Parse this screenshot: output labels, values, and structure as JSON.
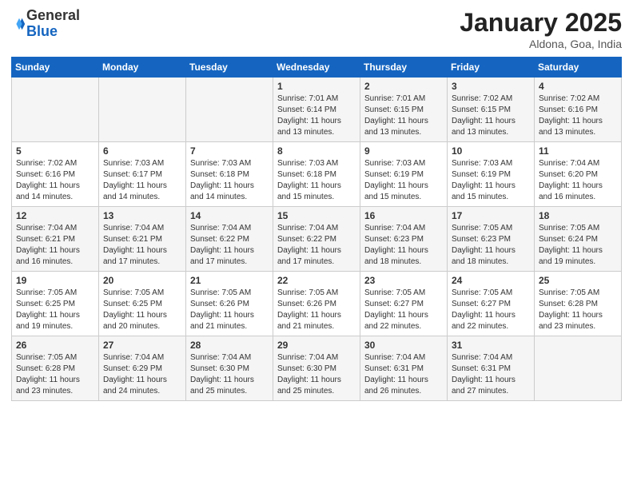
{
  "logo": {
    "general": "General",
    "blue": "Blue"
  },
  "header": {
    "title": "January 2025",
    "subtitle": "Aldona, Goa, India"
  },
  "weekdays": [
    "Sunday",
    "Monday",
    "Tuesday",
    "Wednesday",
    "Thursday",
    "Friday",
    "Saturday"
  ],
  "weeks": [
    [
      {
        "day": "",
        "info": ""
      },
      {
        "day": "",
        "info": ""
      },
      {
        "day": "",
        "info": ""
      },
      {
        "day": "1",
        "info": "Sunrise: 7:01 AM\nSunset: 6:14 PM\nDaylight: 11 hours\nand 13 minutes."
      },
      {
        "day": "2",
        "info": "Sunrise: 7:01 AM\nSunset: 6:15 PM\nDaylight: 11 hours\nand 13 minutes."
      },
      {
        "day": "3",
        "info": "Sunrise: 7:02 AM\nSunset: 6:15 PM\nDaylight: 11 hours\nand 13 minutes."
      },
      {
        "day": "4",
        "info": "Sunrise: 7:02 AM\nSunset: 6:16 PM\nDaylight: 11 hours\nand 13 minutes."
      }
    ],
    [
      {
        "day": "5",
        "info": "Sunrise: 7:02 AM\nSunset: 6:16 PM\nDaylight: 11 hours\nand 14 minutes."
      },
      {
        "day": "6",
        "info": "Sunrise: 7:03 AM\nSunset: 6:17 PM\nDaylight: 11 hours\nand 14 minutes."
      },
      {
        "day": "7",
        "info": "Sunrise: 7:03 AM\nSunset: 6:18 PM\nDaylight: 11 hours\nand 14 minutes."
      },
      {
        "day": "8",
        "info": "Sunrise: 7:03 AM\nSunset: 6:18 PM\nDaylight: 11 hours\nand 15 minutes."
      },
      {
        "day": "9",
        "info": "Sunrise: 7:03 AM\nSunset: 6:19 PM\nDaylight: 11 hours\nand 15 minutes."
      },
      {
        "day": "10",
        "info": "Sunrise: 7:03 AM\nSunset: 6:19 PM\nDaylight: 11 hours\nand 15 minutes."
      },
      {
        "day": "11",
        "info": "Sunrise: 7:04 AM\nSunset: 6:20 PM\nDaylight: 11 hours\nand 16 minutes."
      }
    ],
    [
      {
        "day": "12",
        "info": "Sunrise: 7:04 AM\nSunset: 6:21 PM\nDaylight: 11 hours\nand 16 minutes."
      },
      {
        "day": "13",
        "info": "Sunrise: 7:04 AM\nSunset: 6:21 PM\nDaylight: 11 hours\nand 17 minutes."
      },
      {
        "day": "14",
        "info": "Sunrise: 7:04 AM\nSunset: 6:22 PM\nDaylight: 11 hours\nand 17 minutes."
      },
      {
        "day": "15",
        "info": "Sunrise: 7:04 AM\nSunset: 6:22 PM\nDaylight: 11 hours\nand 17 minutes."
      },
      {
        "day": "16",
        "info": "Sunrise: 7:04 AM\nSunset: 6:23 PM\nDaylight: 11 hours\nand 18 minutes."
      },
      {
        "day": "17",
        "info": "Sunrise: 7:05 AM\nSunset: 6:23 PM\nDaylight: 11 hours\nand 18 minutes."
      },
      {
        "day": "18",
        "info": "Sunrise: 7:05 AM\nSunset: 6:24 PM\nDaylight: 11 hours\nand 19 minutes."
      }
    ],
    [
      {
        "day": "19",
        "info": "Sunrise: 7:05 AM\nSunset: 6:25 PM\nDaylight: 11 hours\nand 19 minutes."
      },
      {
        "day": "20",
        "info": "Sunrise: 7:05 AM\nSunset: 6:25 PM\nDaylight: 11 hours\nand 20 minutes."
      },
      {
        "day": "21",
        "info": "Sunrise: 7:05 AM\nSunset: 6:26 PM\nDaylight: 11 hours\nand 21 minutes."
      },
      {
        "day": "22",
        "info": "Sunrise: 7:05 AM\nSunset: 6:26 PM\nDaylight: 11 hours\nand 21 minutes."
      },
      {
        "day": "23",
        "info": "Sunrise: 7:05 AM\nSunset: 6:27 PM\nDaylight: 11 hours\nand 22 minutes."
      },
      {
        "day": "24",
        "info": "Sunrise: 7:05 AM\nSunset: 6:27 PM\nDaylight: 11 hours\nand 22 minutes."
      },
      {
        "day": "25",
        "info": "Sunrise: 7:05 AM\nSunset: 6:28 PM\nDaylight: 11 hours\nand 23 minutes."
      }
    ],
    [
      {
        "day": "26",
        "info": "Sunrise: 7:05 AM\nSunset: 6:28 PM\nDaylight: 11 hours\nand 23 minutes."
      },
      {
        "day": "27",
        "info": "Sunrise: 7:04 AM\nSunset: 6:29 PM\nDaylight: 11 hours\nand 24 minutes."
      },
      {
        "day": "28",
        "info": "Sunrise: 7:04 AM\nSunset: 6:30 PM\nDaylight: 11 hours\nand 25 minutes."
      },
      {
        "day": "29",
        "info": "Sunrise: 7:04 AM\nSunset: 6:30 PM\nDaylight: 11 hours\nand 25 minutes."
      },
      {
        "day": "30",
        "info": "Sunrise: 7:04 AM\nSunset: 6:31 PM\nDaylight: 11 hours\nand 26 minutes."
      },
      {
        "day": "31",
        "info": "Sunrise: 7:04 AM\nSunset: 6:31 PM\nDaylight: 11 hours\nand 27 minutes."
      },
      {
        "day": "",
        "info": ""
      }
    ]
  ]
}
